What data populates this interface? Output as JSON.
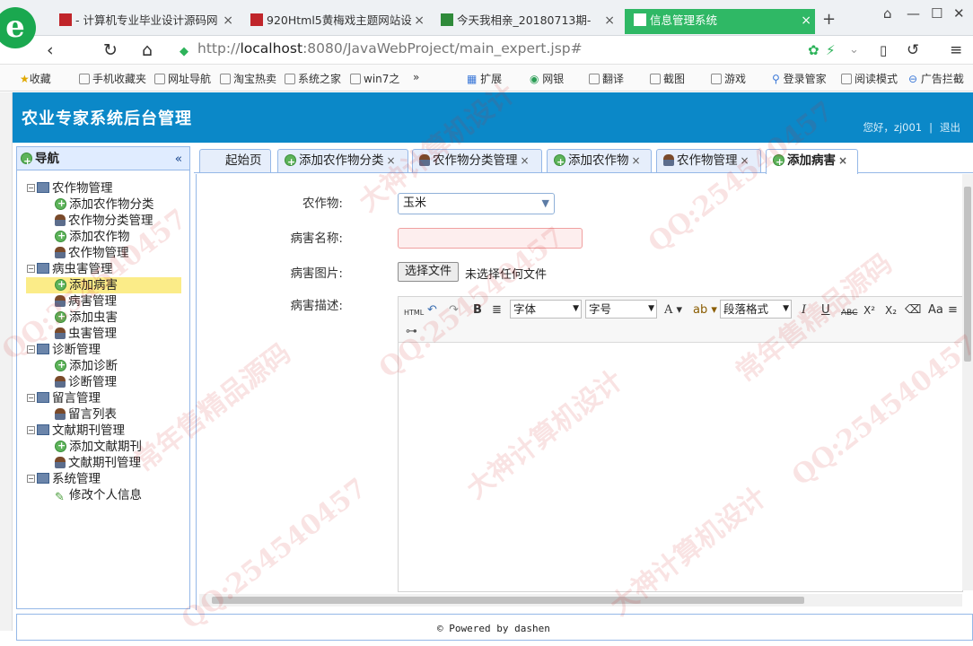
{
  "browser": {
    "tabs": [
      {
        "title": "- 计算机专业毕业设计源码网",
        "active": false
      },
      {
        "title": "920Html5黄梅戏主题网站设",
        "active": false
      },
      {
        "title": "今天我相亲_20180713期-",
        "active": false
      },
      {
        "title": "信息管理系统",
        "active": true
      }
    ],
    "new_tab": "+",
    "url_prefix": "http://",
    "url_host": "localhost",
    "url_path": ":8080/JavaWebProject/main_expert.jsp#",
    "bookmarks": [
      "收藏",
      "手机收藏夹",
      "网址导航",
      "淘宝热卖",
      "系统之家",
      "win7之",
      "»",
      "扩展",
      "网银",
      "翻译",
      "截图",
      "游戏",
      "登录管家",
      "阅读模式",
      "广告拦截"
    ]
  },
  "banner": {
    "title": "农业专家系统后台管理",
    "greeting": "您好，zj001",
    "separator": "|",
    "logout": "退出"
  },
  "sidebar": {
    "title": "导航",
    "collapse": "«",
    "groups": [
      {
        "label": "农作物管理",
        "items": [
          "添加农作物分类",
          "农作物分类管理",
          "添加农作物",
          "农作物管理"
        ]
      },
      {
        "label": "病虫害管理",
        "items": [
          "添加病害",
          "病害管理",
          "添加虫害",
          "虫害管理"
        ]
      },
      {
        "label": "诊断管理",
        "items": [
          "添加诊断",
          "诊断管理"
        ]
      },
      {
        "label": "留言管理",
        "items": [
          "留言列表"
        ]
      },
      {
        "label": "文献期刊管理",
        "items": [
          "添加文献期刊",
          "文献期刊管理"
        ]
      },
      {
        "label": "系统管理",
        "items": [
          "修改个人信息"
        ]
      }
    ]
  },
  "tabs": [
    {
      "label": "起始页",
      "closable": false
    },
    {
      "label": "添加农作物分类",
      "closable": true
    },
    {
      "label": "农作物分类管理",
      "closable": true
    },
    {
      "label": "添加农作物",
      "closable": true
    },
    {
      "label": "农作物管理",
      "closable": true
    },
    {
      "label": "添加病害",
      "closable": true,
      "active": true
    }
  ],
  "form": {
    "crop_label": "农作物:",
    "crop_value": "玉米",
    "name_label": "病害名称:",
    "name_value": "",
    "image_label": "病害图片:",
    "file_button": "选择文件",
    "file_status": "未选择任何文件",
    "desc_label": "病害描述:"
  },
  "editor_toolbar": {
    "html": "HTML",
    "bold": "B",
    "font": "字体",
    "size": "字号",
    "font_color": "A",
    "paragraph": "段落格式",
    "italic": "I",
    "underline": "U",
    "strike": "ABC",
    "superscript": "X²",
    "subscript": "X₂"
  },
  "footer": {
    "text": "© Powered by dashen"
  },
  "watermarks": [
    "QQ:254540457",
    "大神计算机设计",
    "常年售精品源码"
  ]
}
